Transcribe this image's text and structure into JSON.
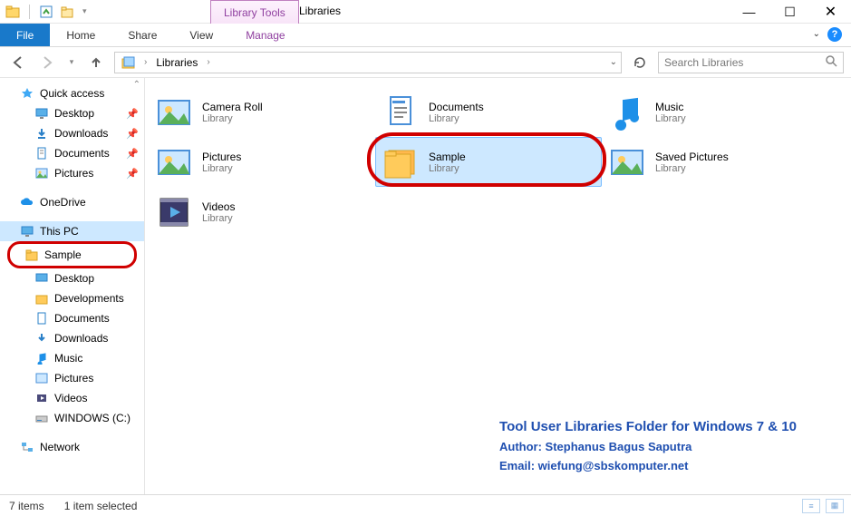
{
  "titlebar": {
    "library_tools_label": "Library Tools",
    "title": "Libraries"
  },
  "win": {
    "min": "—",
    "max": "☐",
    "close": "✕"
  },
  "ribbon": {
    "file": "File",
    "tabs": [
      "Home",
      "Share",
      "View"
    ],
    "manage": "Manage"
  },
  "nav": {
    "crumb": "Libraries",
    "search_placeholder": "Search Libraries"
  },
  "sidebar": {
    "quick_access": "Quick access",
    "qa_items": [
      {
        "label": "Desktop",
        "pin": true
      },
      {
        "label": "Downloads",
        "pin": true
      },
      {
        "label": "Documents",
        "pin": true
      },
      {
        "label": "Pictures",
        "pin": true
      }
    ],
    "onedrive": "OneDrive",
    "this_pc": "This PC",
    "pc_items": [
      {
        "label": "Sample",
        "circled": true,
        "icon": "folder"
      },
      {
        "label": "Desktop",
        "icon": "monitor"
      },
      {
        "label": "Developments",
        "icon": "folder"
      },
      {
        "label": "Documents",
        "icon": "doc"
      },
      {
        "label": "Downloads",
        "icon": "down"
      },
      {
        "label": "Music",
        "icon": "music"
      },
      {
        "label": "Pictures",
        "icon": "pic"
      },
      {
        "label": "Videos",
        "icon": "video"
      },
      {
        "label": "WINDOWS (C:)",
        "icon": "drive"
      }
    ],
    "network": "Network"
  },
  "content": {
    "items": [
      {
        "name": "Camera Roll",
        "sub": "Library",
        "icon": "pic"
      },
      {
        "name": "Documents",
        "sub": "Library",
        "icon": "doc"
      },
      {
        "name": "Music",
        "sub": "Library",
        "icon": "music"
      },
      {
        "name": "Pictures",
        "sub": "Library",
        "icon": "pic"
      },
      {
        "name": "Sample",
        "sub": "Library",
        "icon": "folder",
        "selected": true,
        "circled": true
      },
      {
        "name": "Saved Pictures",
        "sub": "Library",
        "icon": "pic"
      },
      {
        "name": "Videos",
        "sub": "Library",
        "icon": "video"
      }
    ]
  },
  "overlay": {
    "title": "Tool User Libraries Folder for Windows 7 & 10",
    "author": "Author: Stephanus Bagus Saputra",
    "email": "Email: wiefung@sbskomputer.net"
  },
  "status": {
    "count": "7 items",
    "selection": "1 item selected"
  }
}
